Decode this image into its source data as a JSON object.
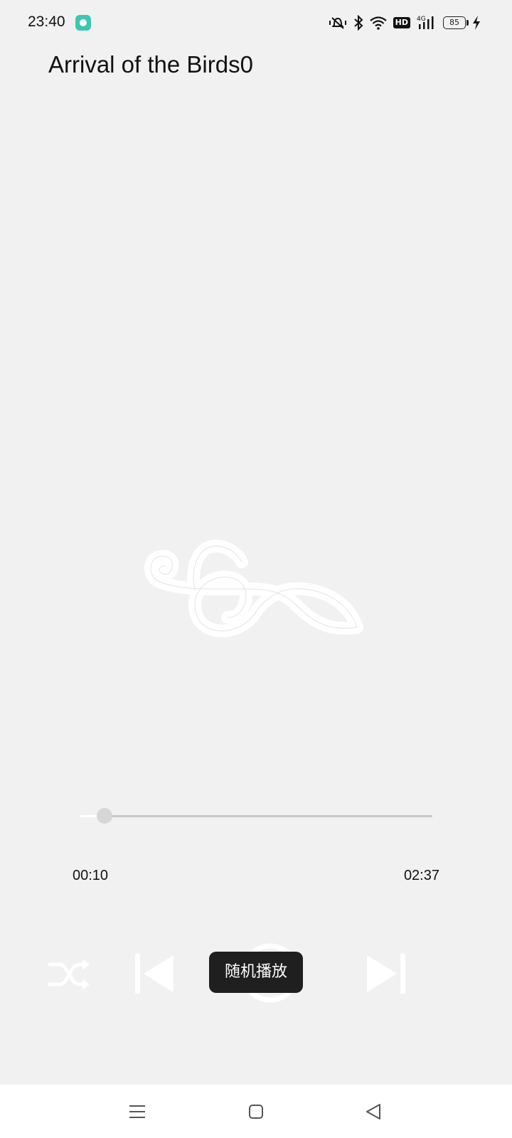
{
  "status_bar": {
    "time": "23:40",
    "network": "4G",
    "hd_label": "HD",
    "battery": "85",
    "icons": [
      "app-notification-icon",
      "mute-vibrate-icon",
      "bluetooth-icon",
      "wifi-icon",
      "hd-icon",
      "signal-icon",
      "battery-icon",
      "charging-icon"
    ]
  },
  "player": {
    "title": "Arrival of the Birds0",
    "current_time": "00:10",
    "total_time": "02:37",
    "progress": 0.07,
    "artwork_icon": "treble-clef-icon",
    "controls": [
      "shuffle-icon",
      "previous-icon",
      "play-pause-icon",
      "next-icon"
    ]
  },
  "toast": {
    "text": "随机播放"
  },
  "nav_bar": {
    "icons": [
      "menu-icon",
      "home-icon",
      "back-icon"
    ]
  }
}
